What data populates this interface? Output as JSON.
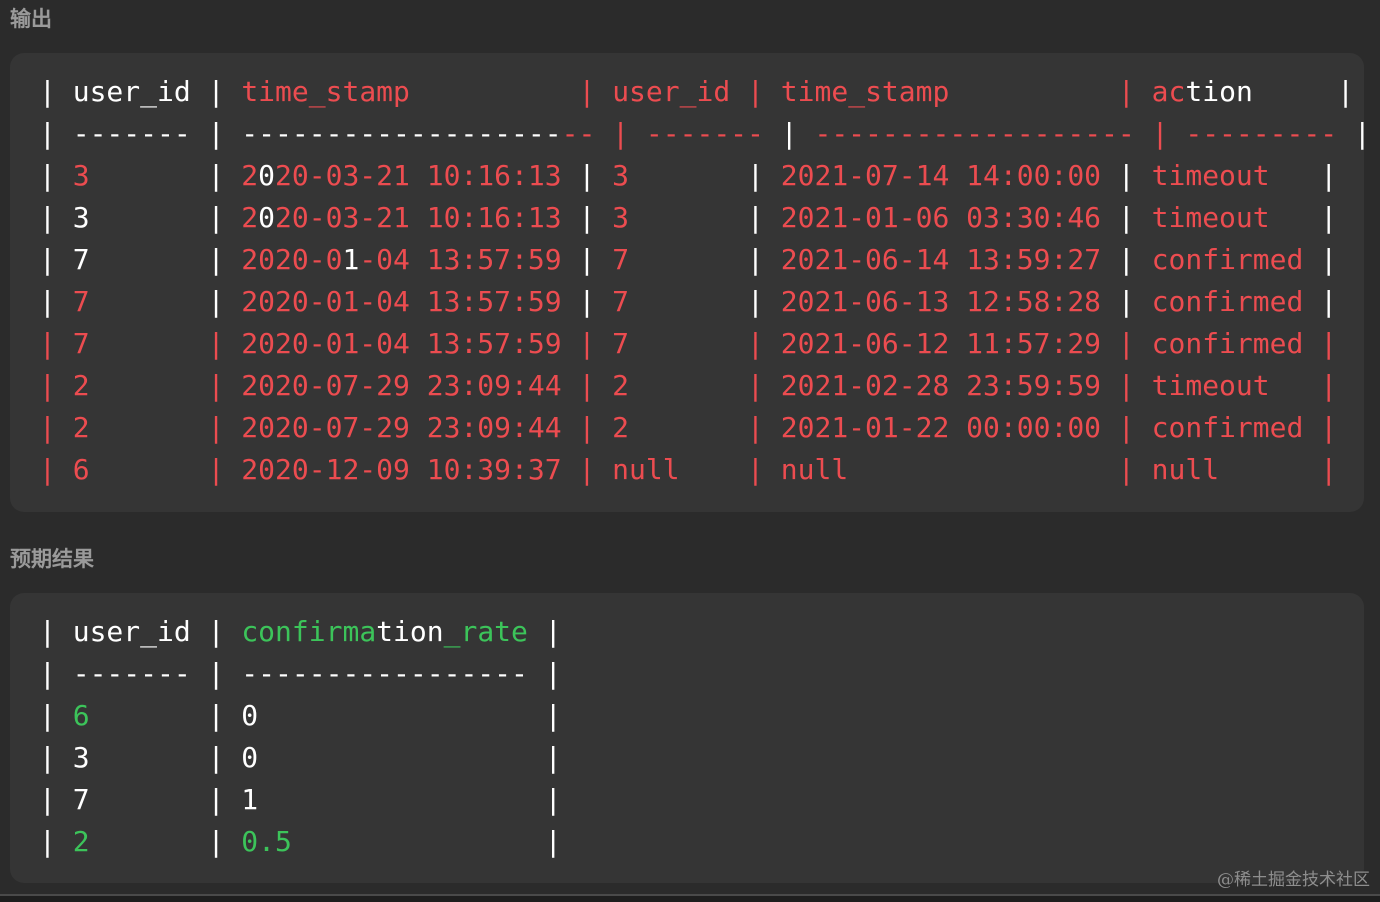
{
  "labels": {
    "output": "输出",
    "expected": "预期结果"
  },
  "output_table": {
    "lines": [
      [
        [
          "w",
          "| "
        ],
        [
          "w",
          "user_id"
        ],
        [
          "w",
          " | "
        ],
        [
          "r",
          "time_stamp          "
        ],
        [
          "r",
          "| "
        ],
        [
          "r",
          "user_id"
        ],
        [
          "r",
          " | "
        ],
        [
          "r",
          "time_stamp         "
        ],
        [
          "r",
          " | "
        ],
        [
          "r",
          "ac"
        ],
        [
          "w",
          "tion     "
        ],
        [
          "w",
          "|"
        ]
      ],
      [
        [
          "w",
          "| "
        ],
        [
          "w",
          "------- "
        ],
        [
          "w",
          "| "
        ],
        [
          "w",
          "-------------------"
        ],
        [
          "r",
          "-- "
        ],
        [
          "r",
          "| "
        ],
        [
          "r",
          "------- "
        ],
        [
          "w",
          "| "
        ],
        [
          "r",
          "------------------- "
        ],
        [
          "r",
          "| "
        ],
        [
          "r",
          "--------- "
        ],
        [
          "w",
          "|"
        ]
      ],
      [
        [
          "w",
          "| "
        ],
        [
          "r",
          "3"
        ],
        [
          "w",
          "       | "
        ],
        [
          "r",
          "2"
        ],
        [
          "w",
          "0"
        ],
        [
          "r",
          "20-03-21 10:16:13 "
        ],
        [
          "w",
          "| "
        ],
        [
          "r",
          "3       "
        ],
        [
          "w",
          "| "
        ],
        [
          "r",
          "2021-07-14 14:00:00 "
        ],
        [
          "w",
          "| "
        ],
        [
          "r",
          "timeout   "
        ],
        [
          "w",
          "|"
        ]
      ],
      [
        [
          "w",
          "| "
        ],
        [
          "w",
          "3"
        ],
        [
          "w",
          "       | "
        ],
        [
          "r",
          "2"
        ],
        [
          "w",
          "0"
        ],
        [
          "r",
          "20-03-21 10:16:13 "
        ],
        [
          "w",
          "| "
        ],
        [
          "r",
          "3       "
        ],
        [
          "w",
          "| "
        ],
        [
          "r",
          "2021-01-06 03:30:46 "
        ],
        [
          "w",
          "| "
        ],
        [
          "r",
          "timeout   "
        ],
        [
          "w",
          "|"
        ]
      ],
      [
        [
          "w",
          "| "
        ],
        [
          "w",
          "7"
        ],
        [
          "w",
          "       | "
        ],
        [
          "r",
          "2020-0"
        ],
        [
          "w",
          "1"
        ],
        [
          "r",
          "-04 13:57:59 "
        ],
        [
          "w",
          "| "
        ],
        [
          "r",
          "7       "
        ],
        [
          "w",
          "| "
        ],
        [
          "r",
          "2021-06-14 13:59:27 "
        ],
        [
          "w",
          "| "
        ],
        [
          "r",
          "confirmed "
        ],
        [
          "w",
          "|"
        ]
      ],
      [
        [
          "w",
          "| "
        ],
        [
          "r",
          "7"
        ],
        [
          "w",
          "       | "
        ],
        [
          "r",
          "2020-01-04 13:57:59 "
        ],
        [
          "w",
          "| "
        ],
        [
          "r",
          "7       "
        ],
        [
          "w",
          "| "
        ],
        [
          "r",
          "2021-06-13 12:58:28 "
        ],
        [
          "w",
          "| "
        ],
        [
          "r",
          "confirmed "
        ],
        [
          "w",
          "|"
        ]
      ],
      [
        [
          "r",
          "| "
        ],
        [
          "r",
          "7"
        ],
        [
          "r",
          "       | "
        ],
        [
          "r",
          "2020-01-04 13:57:59 "
        ],
        [
          "r",
          "| "
        ],
        [
          "r",
          "7       "
        ],
        [
          "r",
          "| "
        ],
        [
          "r",
          "2021-06-12 11:57:29 "
        ],
        [
          "r",
          "| "
        ],
        [
          "r",
          "confirmed "
        ],
        [
          "r",
          "|"
        ]
      ],
      [
        [
          "r",
          "| "
        ],
        [
          "r",
          "2"
        ],
        [
          "r",
          "       | "
        ],
        [
          "r",
          "2020-07-29 23:09:44 "
        ],
        [
          "r",
          "| "
        ],
        [
          "r",
          "2       "
        ],
        [
          "r",
          "| "
        ],
        [
          "r",
          "2021-02-28 23:59:59 "
        ],
        [
          "r",
          "| "
        ],
        [
          "r",
          "timeout   "
        ],
        [
          "r",
          "|"
        ]
      ],
      [
        [
          "r",
          "| "
        ],
        [
          "r",
          "2"
        ],
        [
          "r",
          "       | "
        ],
        [
          "r",
          "2020-07-29 23:09:44 "
        ],
        [
          "r",
          "| "
        ],
        [
          "r",
          "2       "
        ],
        [
          "r",
          "| "
        ],
        [
          "r",
          "2021-01-22 00:00:00 "
        ],
        [
          "r",
          "| "
        ],
        [
          "r",
          "confirmed "
        ],
        [
          "r",
          "|"
        ]
      ],
      [
        [
          "r",
          "| "
        ],
        [
          "r",
          "6"
        ],
        [
          "r",
          "       | "
        ],
        [
          "r",
          "2020-12-09 10:39:37 "
        ],
        [
          "r",
          "| "
        ],
        [
          "r",
          "null    "
        ],
        [
          "r",
          "| "
        ],
        [
          "r",
          "null                "
        ],
        [
          "r",
          "| "
        ],
        [
          "r",
          "null      "
        ],
        [
          "r",
          "|"
        ]
      ]
    ]
  },
  "expected_table": {
    "lines": [
      [
        [
          "w",
          "| "
        ],
        [
          "w",
          "user_id"
        ],
        [
          "w",
          " | "
        ],
        [
          "g",
          "confirma"
        ],
        [
          "w",
          "tion"
        ],
        [
          "g",
          "_rate"
        ],
        [
          "w",
          " |"
        ]
      ],
      [
        [
          "w",
          "| "
        ],
        [
          "w",
          "------- "
        ],
        [
          "w",
          "| "
        ],
        [
          "w",
          "----------------- "
        ],
        [
          "w",
          "|"
        ]
      ],
      [
        [
          "w",
          "| "
        ],
        [
          "g",
          "6"
        ],
        [
          "w",
          "       | "
        ],
        [
          "w",
          "0                 "
        ],
        [
          "w",
          "|"
        ]
      ],
      [
        [
          "w",
          "| "
        ],
        [
          "w",
          "3"
        ],
        [
          "w",
          "       | "
        ],
        [
          "w",
          "0                 "
        ],
        [
          "w",
          "|"
        ]
      ],
      [
        [
          "w",
          "| "
        ],
        [
          "w",
          "7"
        ],
        [
          "w",
          "       | "
        ],
        [
          "w",
          "1                 "
        ],
        [
          "w",
          "|"
        ]
      ],
      [
        [
          "w",
          "| "
        ],
        [
          "g",
          "2"
        ],
        [
          "w",
          "       | "
        ],
        [
          "g",
          "0.5"
        ],
        [
          "w",
          "               "
        ],
        [
          "w",
          "|"
        ]
      ]
    ]
  },
  "watermark": "@稀土掘金技术社区",
  "colors": {
    "background": "#2b2b2b",
    "panel": "#353535",
    "text_default": "#ffffff",
    "diff_removed": "#ec4c50",
    "diff_added": "#3cc45a",
    "label": "#9a9a9a"
  }
}
